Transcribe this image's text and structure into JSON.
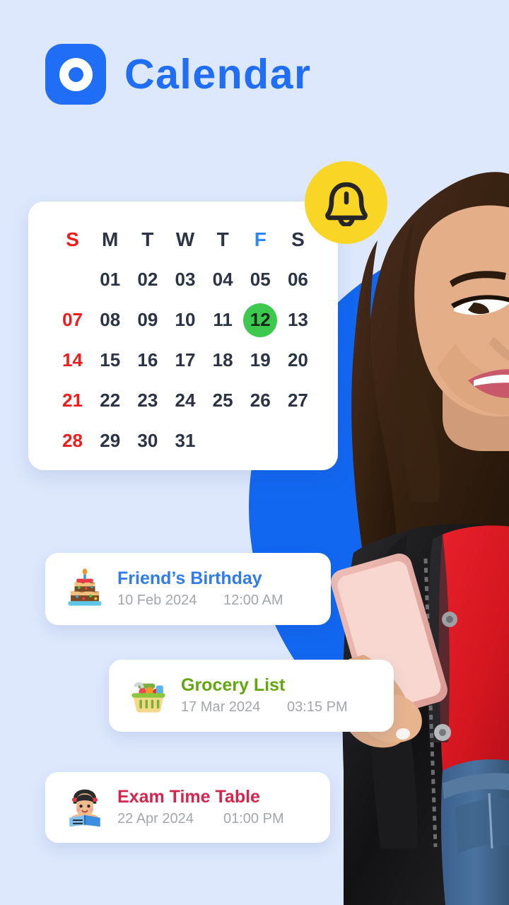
{
  "app": {
    "title": "Calendar",
    "logo_icon": "ring-logo-icon",
    "brand_color": "#1f6ef5",
    "background_color": "#dde8fd",
    "circle_color": "#1267f0"
  },
  "notification": {
    "icon": "bell-icon",
    "badge_color": "#f9d525",
    "icon_color": "#262626"
  },
  "calendar": {
    "weekday_headers": [
      {
        "label": "S",
        "kind": "sun"
      },
      {
        "label": "M",
        "kind": "wd"
      },
      {
        "label": "T",
        "kind": "wd"
      },
      {
        "label": "W",
        "kind": "wd"
      },
      {
        "label": "T",
        "kind": "wd"
      },
      {
        "label": "F",
        "kind": "fri"
      },
      {
        "label": "S",
        "kind": "wd"
      }
    ],
    "leading_blanks": 1,
    "days": [
      "01",
      "02",
      "03",
      "04",
      "05",
      "06",
      "07",
      "08",
      "09",
      "10",
      "11",
      "12",
      "13",
      "14",
      "15",
      "16",
      "17",
      "18",
      "19",
      "20",
      "21",
      "22",
      "23",
      "24",
      "25",
      "26",
      "27",
      "28",
      "29",
      "30",
      "31"
    ],
    "selected_day": "12",
    "selected_day_color": "#3cc94e",
    "sunday_color": "#f21b1b",
    "friday_color": "#2f86f6",
    "weekday_color": "#2b3445"
  },
  "events": [
    {
      "icon": "birthday-cake-icon",
      "title": "Friend’s Birthday",
      "title_color": "#2f7cea",
      "date": "10 Feb 2024",
      "time": "12:00 AM"
    },
    {
      "icon": "shopping-basket-icon",
      "title": "Grocery List",
      "title_color": "#63a70f",
      "date": "17 Mar 2024",
      "time": "03:15 PM"
    },
    {
      "icon": "person-reading-icon",
      "title": "Exam Time Table",
      "title_color": "#d5254c",
      "date": "22 Apr 2024",
      "time": "01:00 PM"
    }
  ]
}
